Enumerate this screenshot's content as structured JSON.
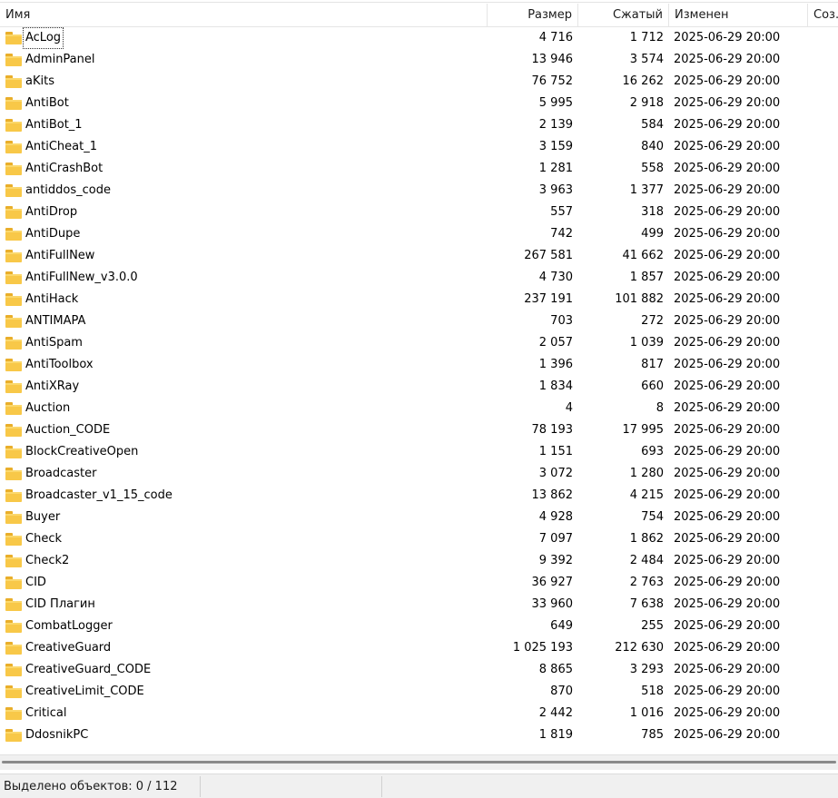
{
  "columns": {
    "name": "Имя",
    "size": "Размер",
    "packed": "Сжатый",
    "modified": "Изменен",
    "created": "Соз..."
  },
  "rows": [
    {
      "name": "AcLog",
      "size": "4 716",
      "packed": "1 712",
      "modified": "2025-06-29 20:00"
    },
    {
      "name": "AdminPanel",
      "size": "13 946",
      "packed": "3 574",
      "modified": "2025-06-29 20:00"
    },
    {
      "name": "aKits",
      "size": "76 752",
      "packed": "16 262",
      "modified": "2025-06-29 20:00"
    },
    {
      "name": "AntiBot",
      "size": "5 995",
      "packed": "2 918",
      "modified": "2025-06-29 20:00"
    },
    {
      "name": "AntiBot_1",
      "size": "2 139",
      "packed": "584",
      "modified": "2025-06-29 20:00"
    },
    {
      "name": "AntiCheat_1",
      "size": "3 159",
      "packed": "840",
      "modified": "2025-06-29 20:00"
    },
    {
      "name": "AntiCrashBot",
      "size": "1 281",
      "packed": "558",
      "modified": "2025-06-29 20:00"
    },
    {
      "name": "antiddos_code",
      "size": "3 963",
      "packed": "1 377",
      "modified": "2025-06-29 20:00"
    },
    {
      "name": "AntiDrop",
      "size": "557",
      "packed": "318",
      "modified": "2025-06-29 20:00"
    },
    {
      "name": "AntiDupe",
      "size": "742",
      "packed": "499",
      "modified": "2025-06-29 20:00"
    },
    {
      "name": "AntiFullNew",
      "size": "267 581",
      "packed": "41 662",
      "modified": "2025-06-29 20:00"
    },
    {
      "name": "AntiFullNew_v3.0.0",
      "size": "4 730",
      "packed": "1 857",
      "modified": "2025-06-29 20:00"
    },
    {
      "name": "AntiHack",
      "size": "237 191",
      "packed": "101 882",
      "modified": "2025-06-29 20:00"
    },
    {
      "name": "ANTIMAPA",
      "size": "703",
      "packed": "272",
      "modified": "2025-06-29 20:00"
    },
    {
      "name": "AntiSpam",
      "size": "2 057",
      "packed": "1 039",
      "modified": "2025-06-29 20:00"
    },
    {
      "name": "AntiToolbox",
      "size": "1 396",
      "packed": "817",
      "modified": "2025-06-29 20:00"
    },
    {
      "name": "AntiXRay",
      "size": "1 834",
      "packed": "660",
      "modified": "2025-06-29 20:00"
    },
    {
      "name": "Auction",
      "size": "4",
      "packed": "8",
      "modified": "2025-06-29 20:00"
    },
    {
      "name": "Auction_CODE",
      "size": "78 193",
      "packed": "17 995",
      "modified": "2025-06-29 20:00"
    },
    {
      "name": "BlockCreativeOpen",
      "size": "1 151",
      "packed": "693",
      "modified": "2025-06-29 20:00"
    },
    {
      "name": "Broadcaster",
      "size": "3 072",
      "packed": "1 280",
      "modified": "2025-06-29 20:00"
    },
    {
      "name": "Broadcaster_v1_15_code",
      "size": "13 862",
      "packed": "4 215",
      "modified": "2025-06-29 20:00"
    },
    {
      "name": "Buyer",
      "size": "4 928",
      "packed": "754",
      "modified": "2025-06-29 20:00"
    },
    {
      "name": "Check",
      "size": "7 097",
      "packed": "1 862",
      "modified": "2025-06-29 20:00"
    },
    {
      "name": "Check2",
      "size": "9 392",
      "packed": "2 484",
      "modified": "2025-06-29 20:00"
    },
    {
      "name": "CID",
      "size": "36 927",
      "packed": "2 763",
      "modified": "2025-06-29 20:00"
    },
    {
      "name": "CID Плагин",
      "size": "33 960",
      "packed": "7 638",
      "modified": "2025-06-29 20:00"
    },
    {
      "name": "CombatLogger",
      "size": "649",
      "packed": "255",
      "modified": "2025-06-29 20:00"
    },
    {
      "name": "CreativeGuard",
      "size": "1 025 193",
      "packed": "212 630",
      "modified": "2025-06-29 20:00"
    },
    {
      "name": "CreativeGuard_CODE",
      "size": "8 865",
      "packed": "3 293",
      "modified": "2025-06-29 20:00"
    },
    {
      "name": "CreativeLimit_CODE",
      "size": "870",
      "packed": "518",
      "modified": "2025-06-29 20:00"
    },
    {
      "name": "Critical",
      "size": "2 442",
      "packed": "1 016",
      "modified": "2025-06-29 20:00"
    },
    {
      "name": "DdosnikPC",
      "size": "1 819",
      "packed": "785",
      "modified": "2025-06-29 20:00"
    }
  ],
  "status": {
    "selection": "Выделено объектов: 0 / 112"
  },
  "colors": {
    "folder": "#f8c848",
    "folder_tab": "#e9ae2a"
  },
  "icons": {
    "row": "folder-icon"
  }
}
